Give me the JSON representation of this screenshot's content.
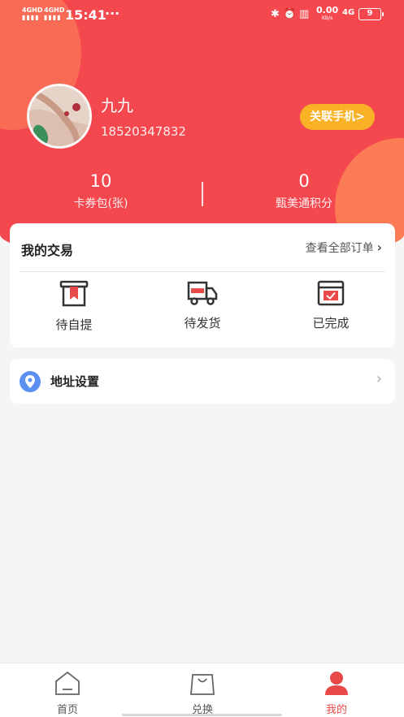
{
  "status_bar": {
    "signal1": "4GHD",
    "signal2": "4GHD",
    "time": "15:41",
    "dots": "···",
    "speed_value": "0.00",
    "speed_unit": "KB/s",
    "network": "4G",
    "battery": "9"
  },
  "profile": {
    "name": "九九",
    "phone": "18520347832",
    "link_phone_button": "关联手机>"
  },
  "stats": [
    {
      "value": "10",
      "label": "卡券包(张)"
    },
    {
      "value": "0",
      "label": "甄美通积分"
    }
  ],
  "trade": {
    "title": "我的交易",
    "view_all": "查看全部订单",
    "actions": [
      {
        "label": "待自提",
        "icon": "pickup-icon"
      },
      {
        "label": "待发货",
        "icon": "delivery-truck-icon"
      },
      {
        "label": "已完成",
        "icon": "completed-icon"
      }
    ]
  },
  "address": {
    "label": "地址设置",
    "icon": "location-pin-icon"
  },
  "tabbar": {
    "tabs": [
      {
        "label": "首页",
        "icon": "home-icon"
      },
      {
        "label": "兑换",
        "icon": "shopping-bag-icon"
      },
      {
        "label": "我的",
        "icon": "user-icon"
      }
    ],
    "active": "我的"
  },
  "colors": {
    "header_red": "#f4474e",
    "accent_orange": "#f9b126",
    "icon_red": "#e84a4a",
    "pin_blue": "#5b8ff0"
  }
}
